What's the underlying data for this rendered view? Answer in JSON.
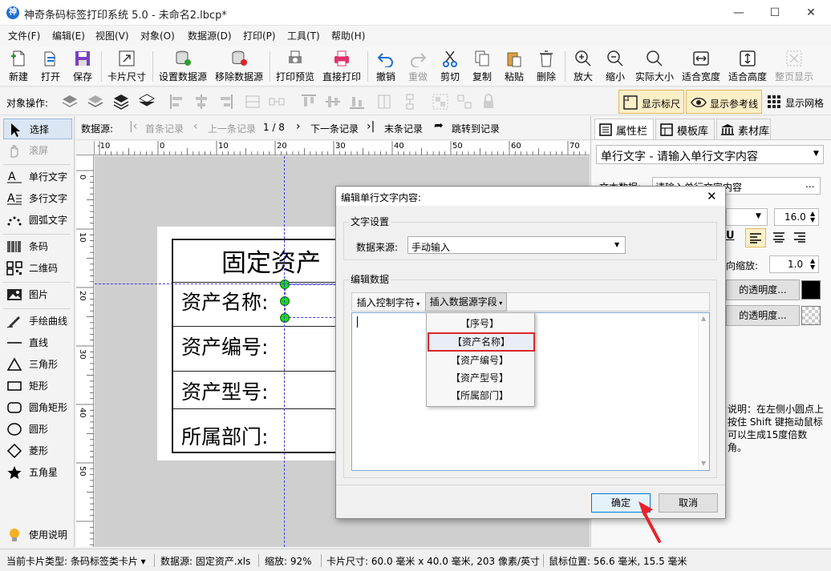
{
  "window": {
    "title": "神奇条码标签打印系统 5.0 - 未命名2.lbcp*",
    "logo_glyph": "神",
    "minimize": "—",
    "maximize": "☐",
    "close": "✕"
  },
  "menu": [
    "文件(F)",
    "编辑(E)",
    "视图(V)",
    "对象(O)",
    "数据源(D)",
    "打印(P)",
    "工具(T)",
    "帮助(H)"
  ],
  "toolbar": {
    "new": "新建",
    "open": "打开",
    "save": "保存",
    "card_size": "卡片尺寸",
    "set_ds": "设置数据源",
    "remove_ds": "移除数据源",
    "print_preview": "打印预览",
    "direct_print": "直接打印",
    "undo": "撤销",
    "redo": "重做",
    "cut": "剪切",
    "copy": "复制",
    "paste": "粘贴",
    "delete": "删除",
    "zoom_in": "放大",
    "zoom_out": "缩小",
    "actual_size": "实际大小",
    "fit_width": "适合宽度",
    "fit_height": "适合高度",
    "whole_page": "整页显示"
  },
  "objbar": {
    "label": "对象操作:",
    "show_ruler": "显示标尺",
    "show_guides": "显示参考线",
    "show_grid": "显示网格"
  },
  "left_tools": [
    "选择",
    "滚屏",
    "单行文字",
    "多行文字",
    "圆弧文字",
    "条码",
    "二维码",
    "图片",
    "手绘曲线",
    "直线",
    "三角形",
    "矩形",
    "圆角矩形",
    "圆形",
    "菱形",
    "五角星",
    "使用说明"
  ],
  "recbar": {
    "label": "数据源:",
    "first": "首条记录",
    "prev": "上一条记录",
    "counter": "1 / 8",
    "next": "下一条记录",
    "last": "末条记录",
    "jump": "跳转到记录"
  },
  "ruler": {
    "h": [
      "-10",
      "0",
      "10",
      "20",
      "30",
      "40",
      "50",
      "60",
      "70"
    ],
    "v": [
      "0",
      "10",
      "20",
      "30",
      "40",
      "50"
    ]
  },
  "card": {
    "title": "固定资产",
    "rows": [
      "资产名称:",
      "资产编号:",
      "资产型号:",
      "所属部门:"
    ]
  },
  "right_panel": {
    "tabs": [
      "属性栏",
      "模板库",
      "素材库"
    ],
    "object_select": "单行文字 - 请输入单行文字内容",
    "text_data_label": "文本数据:",
    "text_data_value": "请输入单行文字内容",
    "more_btn": "...",
    "font_size": "16.0",
    "h_scale_label": "向缩放:",
    "h_scale_value": "1.0",
    "transparency1": "的透明度...",
    "transparency2": "的透明度...",
    "note": "说明：在左侧小圆点上按住 Shift 键拖动鼠标可以生成15度倍数角。",
    "bold_glyph": "U"
  },
  "status": {
    "card_type": "当前卡片类型: 条码标签类卡片 ▾",
    "datasource": "数据源: 固定资产.xls",
    "zoom": "缩放: 92%",
    "card_size": "卡片尺寸: 60.0 毫米 x 40.0 毫米, 203 像素/英寸",
    "mouse_pos": "鼠标位置: 56.6 毫米, 15.5 毫米"
  },
  "dialog": {
    "title": "编辑单行文字内容:",
    "close": "✕",
    "text_settings": "文字设置",
    "data_source_label": "数据来源:",
    "data_source_value": "手动输入",
    "edit_data": "编辑数据",
    "insert_control": "插入控制字符",
    "insert_field": "插入数据源字段",
    "fields": [
      "【序号】",
      "【资产名称】",
      "【资产编号】",
      "【资产型号】",
      "【所属部门】"
    ],
    "highlighted_field": 1,
    "ok": "确定",
    "cancel": "取消"
  },
  "colors": {
    "accent": "#0078d7",
    "highlight_border": "#d9262c",
    "handle": "#1ed61e",
    "arrow": "#e8242b"
  }
}
